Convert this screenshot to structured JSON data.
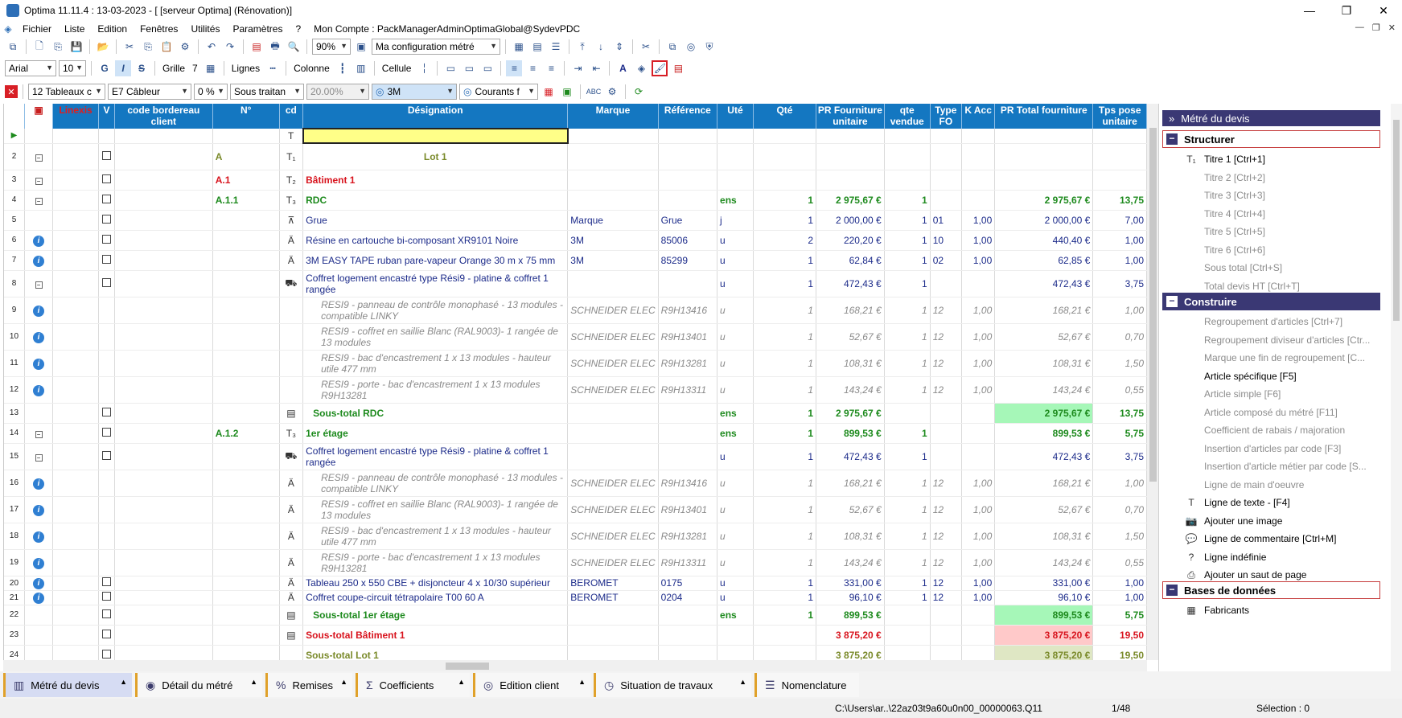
{
  "window": {
    "title": "Optima 11.11.4 : 13-03-2023 - [ [serveur Optima] (Rénovation)]",
    "controls": [
      "—",
      "❐",
      "✕"
    ]
  },
  "menu": {
    "items": [
      "Fichier",
      "Liste",
      "Edition",
      "Fenêtres",
      "Utilités",
      "Paramètres",
      "?",
      "Mon Compte : PackManagerAdminOptimaGlobal@SydevPDC"
    ],
    "mdi": [
      "—",
      "❐",
      "✕"
    ]
  },
  "toolbar1": {
    "zoom": "90%",
    "config": "Ma configuration métré"
  },
  "toolbar2": {
    "font": "Arial",
    "font_size": "10",
    "bold": "G",
    "italic": "I",
    "strike": "S",
    "grid_label": "Grille",
    "grid_value": "7",
    "lines_label": "Lignes",
    "columns_label": "Colonne",
    "cell_label": "Cellule"
  },
  "toolbar3": {
    "tables": "12  Tableaux c",
    "cableur": "E7  Câbleur",
    "percent": "0 %",
    "subtreat": "Sous traitan",
    "rate": "20.00%",
    "brand": "3M",
    "currents": "Courants f"
  },
  "grid": {
    "headers": [
      "",
      "",
      "Linexis",
      "V",
      "code bordereau client",
      "N°",
      "cd",
      "Désignation",
      "Marque",
      "Référence",
      "Uté",
      "Qté",
      "PR Fourniture unitaire",
      "qte vendue",
      "Type FO",
      "K Acc",
      "PR Total fourniture",
      "Tps pose unitaire"
    ],
    "rows": [
      {
        "n": "",
        "num": "",
        "cd": "T",
        "des": "",
        "marque": "",
        "ref": "",
        "ute": "",
        "qte": "",
        "pru": "",
        "qv": "",
        "type": "",
        "k": "",
        "prt": "",
        "tps": "",
        "style": "lotline",
        "cb": false,
        "info": false,
        "minus": false
      },
      {
        "n": "2",
        "num": "A",
        "cd": "T1",
        "des": "Lot 1",
        "marque": "",
        "ref": "",
        "ute": "",
        "qte": "",
        "pru": "",
        "qv": "",
        "type": "",
        "k": "",
        "prt": "",
        "tps": "",
        "style": "lot",
        "cb": true,
        "info": false,
        "minus": true
      },
      {
        "n": "3",
        "num": "A.1",
        "cd": "T2",
        "des": "Bâtiment 1",
        "marque": "",
        "ref": "",
        "ute": "",
        "qte": "",
        "pru": "",
        "qv": "",
        "type": "",
        "k": "",
        "prt": "",
        "tps": "",
        "style": "red",
        "cb": true,
        "info": false,
        "minus": true
      },
      {
        "n": "4",
        "num": "A.1.1",
        "cd": "T3",
        "des": "RDC",
        "marque": "",
        "ref": "",
        "ute": "ens",
        "qte": "1",
        "pru": "2 975,67 €",
        "qv": "1",
        "type": "",
        "k": "",
        "prt": "2 975,67 €",
        "tps": "13,75",
        "style": "green",
        "cb": true,
        "info": false,
        "minus": true
      },
      {
        "n": "5",
        "num": "",
        "cd": "grue",
        "des": "Grue",
        "marque": "Marque",
        "ref": "Grue",
        "ute": "j",
        "qte": "1",
        "pru": "2 000,00 €",
        "qv": "1",
        "type": "01",
        "k": "1,00",
        "prt": "2 000,00 €",
        "tps": "7,00",
        "style": "navy",
        "cb": true,
        "info": false,
        "minus": false
      },
      {
        "n": "6",
        "num": "",
        "cd": "A",
        "des": "Résine en cartouche bi-composant XR9101 Noire",
        "marque": "3M",
        "ref": "85006",
        "ute": "u",
        "qte": "2",
        "pru": "220,20 €",
        "qv": "1",
        "type": "10",
        "k": "1,00",
        "prt": "440,40 €",
        "tps": "1,00",
        "style": "navy",
        "cb": true,
        "info": true,
        "minus": false
      },
      {
        "n": "7",
        "num": "",
        "cd": "A",
        "des": "3M EASY TAPE ruban pare-vapeur Orange 30 m x 75 mm",
        "marque": "3M",
        "ref": "85299",
        "ute": "u",
        "qte": "1",
        "pru": "62,84 €",
        "qv": "1",
        "type": "02",
        "k": "1,00",
        "prt": "62,85 €",
        "tps": "1,00",
        "style": "navy",
        "cb": true,
        "info": true,
        "minus": false
      },
      {
        "n": "8",
        "num": "",
        "cd": "car",
        "des": "Coffret logement encastré type Rési9 - platine & coffret 1 rangée",
        "marque": "",
        "ref": "",
        "ute": "u",
        "qte": "1",
        "pru": "472,43 €",
        "qv": "1",
        "type": "",
        "k": "",
        "prt": "472,43 €",
        "tps": "3,75",
        "style": "navy-tall",
        "cb": true,
        "info": false,
        "minus": true
      },
      {
        "n": "9",
        "num": "",
        "cd": "",
        "des": "RESI9 - panneau de contrôle monophasé - 13 modules - compatible LINKY",
        "marque": "SCHNEIDER ELEC",
        "ref": "R9H13416",
        "ute": "u",
        "qte": "1",
        "pru": "168,21 €",
        "qv": "1",
        "type": "12",
        "k": "1,00",
        "prt": "168,21 €",
        "tps": "1,00",
        "style": "grey",
        "cb": false,
        "info": true,
        "minus": false
      },
      {
        "n": "10",
        "num": "",
        "cd": "",
        "des": "RESI9 - coffret en saillie Blanc (RAL9003)- 1 rangée de 13 modules",
        "marque": "SCHNEIDER ELEC",
        "ref": "R9H13401",
        "ute": "u",
        "qte": "1",
        "pru": "52,67 €",
        "qv": "1",
        "type": "12",
        "k": "1,00",
        "prt": "52,67 €",
        "tps": "0,70",
        "style": "grey",
        "cb": false,
        "info": true,
        "minus": false
      },
      {
        "n": "11",
        "num": "",
        "cd": "",
        "des": "RESI9 - bac d'encastrement 1 x 13 modules - hauteur utile 477 mm",
        "marque": "SCHNEIDER ELEC",
        "ref": "R9H13281",
        "ute": "u",
        "qte": "1",
        "pru": "108,31 €",
        "qv": "1",
        "type": "12",
        "k": "1,00",
        "prt": "108,31 €",
        "tps": "1,50",
        "style": "grey",
        "cb": false,
        "info": true,
        "minus": false
      },
      {
        "n": "12",
        "num": "",
        "cd": "",
        "des": "RESI9 - porte - bac d'encastrement 1 x 13 modules R9H13281",
        "marque": "SCHNEIDER ELEC",
        "ref": "R9H13311",
        "ute": "u",
        "qte": "1",
        "pru": "143,24 €",
        "qv": "1",
        "type": "12",
        "k": "1,00",
        "prt": "143,24 €",
        "tps": "0,55",
        "style": "grey",
        "cb": false,
        "info": true,
        "minus": false
      },
      {
        "n": "13",
        "num": "",
        "cd": "sub",
        "des": "Sous-total RDC",
        "marque": "",
        "ref": "",
        "ute": "ens",
        "qte": "1",
        "pru": "2 975,67 €",
        "qv": "",
        "type": "",
        "k": "",
        "prt": "2 975,67 €",
        "tps": "13,75",
        "style": "subgreen",
        "cb": true,
        "info": false,
        "minus": false
      },
      {
        "n": "14",
        "num": "A.1.2",
        "cd": "T3",
        "des": "1er étage",
        "marque": "",
        "ref": "",
        "ute": "ens",
        "qte": "1",
        "pru": "899,53 €",
        "qv": "1",
        "type": "",
        "k": "",
        "prt": "899,53 €",
        "tps": "5,75",
        "style": "green",
        "cb": true,
        "info": false,
        "minus": true
      },
      {
        "n": "15",
        "num": "",
        "cd": "car",
        "des": "Coffret logement encastré type Rési9 - platine & coffret 1 rangée",
        "marque": "",
        "ref": "",
        "ute": "u",
        "qte": "1",
        "pru": "472,43 €",
        "qv": "1",
        "type": "",
        "k": "",
        "prt": "472,43 €",
        "tps": "3,75",
        "style": "navy-tall",
        "cb": true,
        "info": false,
        "minus": true
      },
      {
        "n": "16",
        "num": "",
        "cd": "A",
        "des": "RESI9 - panneau de contrôle monophasé - 13 modules - compatible LINKY",
        "marque": "SCHNEIDER ELEC",
        "ref": "R9H13416",
        "ute": "u",
        "qte": "1",
        "pru": "168,21 €",
        "qv": "1",
        "type": "12",
        "k": "1,00",
        "prt": "168,21 €",
        "tps": "1,00",
        "style": "grey",
        "cb": false,
        "info": true,
        "minus": false
      },
      {
        "n": "17",
        "num": "",
        "cd": "A",
        "des": "RESI9 - coffret en saillie Blanc (RAL9003)- 1 rangée de 13 modules",
        "marque": "SCHNEIDER ELEC",
        "ref": "R9H13401",
        "ute": "u",
        "qte": "1",
        "pru": "52,67 €",
        "qv": "1",
        "type": "12",
        "k": "1,00",
        "prt": "52,67 €",
        "tps": "0,70",
        "style": "grey",
        "cb": false,
        "info": true,
        "minus": false
      },
      {
        "n": "18",
        "num": "",
        "cd": "A",
        "des": "RESI9 - bac d'encastrement 1 x 13 modules - hauteur utile 477 mm",
        "marque": "SCHNEIDER ELEC",
        "ref": "R9H13281",
        "ute": "u",
        "qte": "1",
        "pru": "108,31 €",
        "qv": "1",
        "type": "12",
        "k": "1,00",
        "prt": "108,31 €",
        "tps": "1,50",
        "style": "grey",
        "cb": false,
        "info": true,
        "minus": false
      },
      {
        "n": "19",
        "num": "",
        "cd": "A",
        "des": "RESI9 - porte - bac d'encastrement 1 x 13 modules R9H13281",
        "marque": "SCHNEIDER ELEC",
        "ref": "R9H13311",
        "ute": "u",
        "qte": "1",
        "pru": "143,24 €",
        "qv": "1",
        "type": "12",
        "k": "1,00",
        "prt": "143,24 €",
        "tps": "0,55",
        "style": "grey",
        "cb": false,
        "info": true,
        "minus": false
      },
      {
        "n": "20",
        "num": "",
        "cd": "A",
        "des": "Tableau 250 x 550 CBE + disjoncteur 4 x 10/30 supérieur",
        "marque": "BEROMET",
        "ref": "0175",
        "ute": "u",
        "qte": "1",
        "pru": "331,00 €",
        "qv": "1",
        "type": "12",
        "k": "1,00",
        "prt": "331,00 €",
        "tps": "1,00",
        "style": "navy-short",
        "cb": true,
        "info": true,
        "minus": false
      },
      {
        "n": "21",
        "num": "",
        "cd": "A",
        "des": "Coffret coupe-circuit tétrapolaire T00 60 A",
        "marque": "BEROMET",
        "ref": "0204",
        "ute": "u",
        "qte": "1",
        "pru": "96,10 €",
        "qv": "1",
        "type": "12",
        "k": "1,00",
        "prt": "96,10 €",
        "tps": "1,00",
        "style": "navy-short",
        "cb": true,
        "info": true,
        "minus": false
      },
      {
        "n": "22",
        "num": "",
        "cd": "sub",
        "des": "Sous-total 1er étage",
        "marque": "",
        "ref": "",
        "ute": "ens",
        "qte": "1",
        "pru": "899,53 €",
        "qv": "",
        "type": "",
        "k": "",
        "prt": "899,53 €",
        "tps": "5,75",
        "style": "subgreen",
        "cb": true,
        "info": false,
        "minus": false
      },
      {
        "n": "23",
        "num": "",
        "cd": "sub",
        "des": "Sous-total Bâtiment 1",
        "marque": "",
        "ref": "",
        "ute": "",
        "qte": "",
        "pru": "3 875,20 €",
        "qv": "",
        "type": "",
        "k": "",
        "prt": "3 875,20 €",
        "tps": "19,50",
        "style": "subred",
        "cb": true,
        "info": false,
        "minus": false
      },
      {
        "n": "24",
        "num": "",
        "cd": "",
        "des": "Sous-total Lot 1",
        "marque": "",
        "ref": "",
        "ute": "",
        "qte": "",
        "pru": "3 875,20 €",
        "qv": "",
        "type": "",
        "k": "",
        "prt": "3 875,20 €",
        "tps": "19,50",
        "style": "sublot",
        "cb": true,
        "info": false,
        "minus": false
      }
    ]
  },
  "right_panel": {
    "header": "Métré du devis",
    "sections": {
      "structurer": "Structurer",
      "construire": "Construire",
      "bases": "Bases de données"
    },
    "structurer_items": [
      {
        "label": "Titre 1 [Ctrl+1]",
        "disabled": false
      },
      {
        "label": "Titre 2 [Ctrl+2]",
        "disabled": true
      },
      {
        "label": "Titre 3 [Ctrl+3]",
        "disabled": true
      },
      {
        "label": "Titre 4 [Ctrl+4]",
        "disabled": true
      },
      {
        "label": "Titre 5 [Ctrl+5]",
        "disabled": true
      },
      {
        "label": "Titre 6 [Ctrl+6]",
        "disabled": true
      },
      {
        "label": "Sous total [Ctrl+S]",
        "disabled": true
      },
      {
        "label": "Total devis HT [Ctrl+T]",
        "disabled": true
      }
    ],
    "construire_items": [
      {
        "label": "Regroupement d'articles  [Ctrl+7]",
        "disabled": true
      },
      {
        "label": "Regroupement diviseur d'articles [Ctr...",
        "disabled": true
      },
      {
        "label": "Marque une fin de regroupement  [C...",
        "disabled": true
      },
      {
        "label": "Article spécifique [F5]",
        "disabled": false
      },
      {
        "label": "Article simple [F6]",
        "disabled": true
      },
      {
        "label": "Article composé du métré [F11]",
        "disabled": true
      },
      {
        "label": "Coefficient de rabais / majoration",
        "disabled": true
      },
      {
        "label": "Insertion d'articles par code [F3]",
        "disabled": true
      },
      {
        "label": "Insertion d'article métier par code [S...",
        "disabled": true
      },
      {
        "label": "Ligne de main d'oeuvre",
        "disabled": true
      },
      {
        "label": "Ligne de texte - [F4]",
        "disabled": false
      },
      {
        "label": "Ajouter une image",
        "disabled": false
      },
      {
        "label": "Ligne de commentaire [Ctrl+M]",
        "disabled": false
      },
      {
        "label": "Ligne indéfinie",
        "disabled": false
      },
      {
        "label": "Ajouter un saut de page",
        "disabled": false
      }
    ],
    "bases_items": [
      {
        "label": "Fabricants",
        "disabled": false
      }
    ]
  },
  "tabs": [
    {
      "label": "Métré du devis",
      "active": true
    },
    {
      "label": "Détail du métré",
      "active": false
    },
    {
      "label": "Remises",
      "active": false
    },
    {
      "label": "Coefficients",
      "active": false
    },
    {
      "label": "Edition client",
      "active": false
    },
    {
      "label": "Situation de travaux",
      "active": false
    },
    {
      "label": "Nomenclature",
      "active": false
    }
  ],
  "status": {
    "path": "C:\\Users\\ar..\\22az03t9a60u0n00_00000063.Q11",
    "page": "1/48",
    "selection": "Sélection : 0"
  }
}
